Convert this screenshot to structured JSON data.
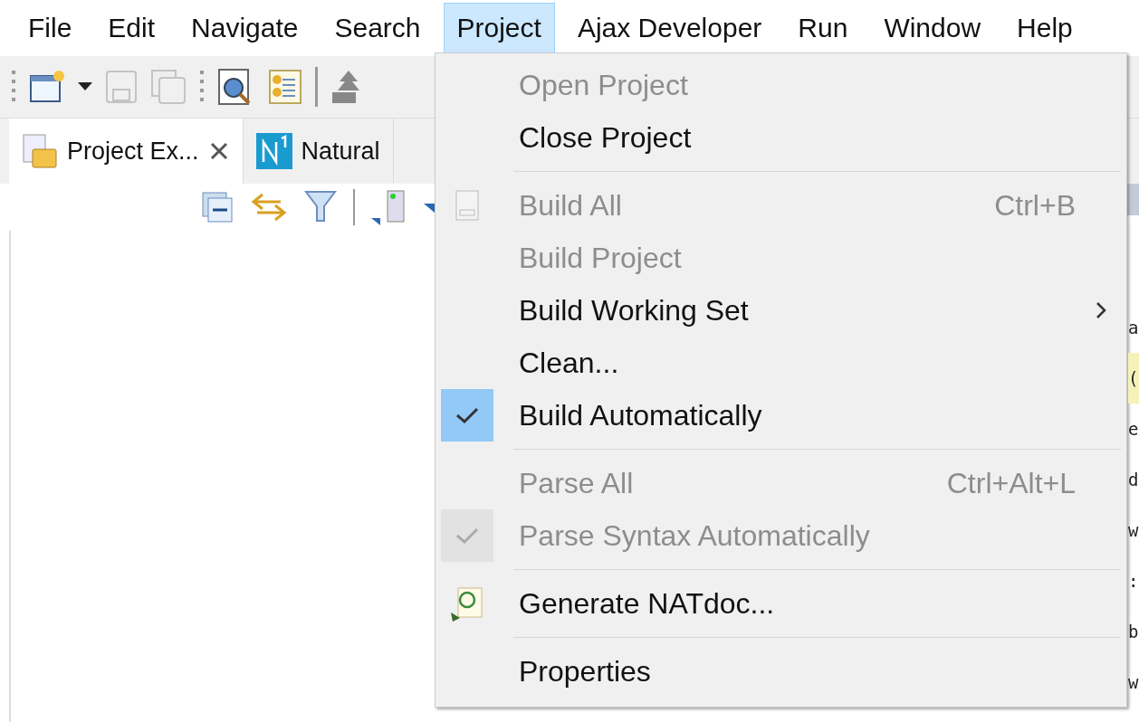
{
  "menu_bar": [
    {
      "label": "File",
      "selected": false
    },
    {
      "label": "Edit",
      "selected": false
    },
    {
      "label": "Navigate",
      "selected": false
    },
    {
      "label": "Search",
      "selected": false
    },
    {
      "label": "Project",
      "selected": true
    },
    {
      "label": "Ajax Developer",
      "selected": false
    },
    {
      "label": "Run",
      "selected": false
    },
    {
      "label": "Window",
      "selected": false
    },
    {
      "label": "Help",
      "selected": false
    }
  ],
  "view_tabs": [
    {
      "label": "Project Ex...",
      "selected": true,
      "kind": "explorer"
    },
    {
      "label": "Natural",
      "selected": false,
      "kind": "natural"
    }
  ],
  "project_menu": [
    {
      "kind": "item",
      "label": "Open Project",
      "disabled": true
    },
    {
      "kind": "item",
      "label": "Close Project",
      "disabled": false
    },
    {
      "kind": "separator"
    },
    {
      "kind": "binary-item",
      "label": "Build All",
      "shortcut": "Ctrl+B",
      "disabled": true
    },
    {
      "kind": "item",
      "label": "Build Project",
      "disabled": true
    },
    {
      "kind": "item",
      "label": "Build Working Set",
      "disabled": false,
      "submenu": true
    },
    {
      "kind": "item",
      "label": "Clean...",
      "disabled": false
    },
    {
      "kind": "item",
      "label": "Build Automatically",
      "disabled": false,
      "checked": true
    },
    {
      "kind": "separator"
    },
    {
      "kind": "item",
      "label": "Parse All",
      "shortcut": "Ctrl+Alt+L",
      "disabled": true
    },
    {
      "kind": "item",
      "label": "Parse Syntax Automatically",
      "disabled": true,
      "checked": true
    },
    {
      "kind": "separator"
    },
    {
      "kind": "doc-item",
      "label": "Generate NATdoc...",
      "disabled": false
    },
    {
      "kind": "separator"
    },
    {
      "kind": "item",
      "label": "Properties",
      "disabled": false
    }
  ],
  "editor_lines": [
    {
      "text": "a",
      "highlighted": false
    },
    {
      "text": "(",
      "highlighted": true
    },
    {
      "text": "e",
      "highlighted": false
    },
    {
      "text": "d",
      "highlighted": false
    },
    {
      "text": "w",
      "highlighted": false
    },
    {
      "text": ":",
      "highlighted": false
    },
    {
      "text": "b",
      "highlighted": false
    },
    {
      "text": "w",
      "highlighted": false
    }
  ]
}
